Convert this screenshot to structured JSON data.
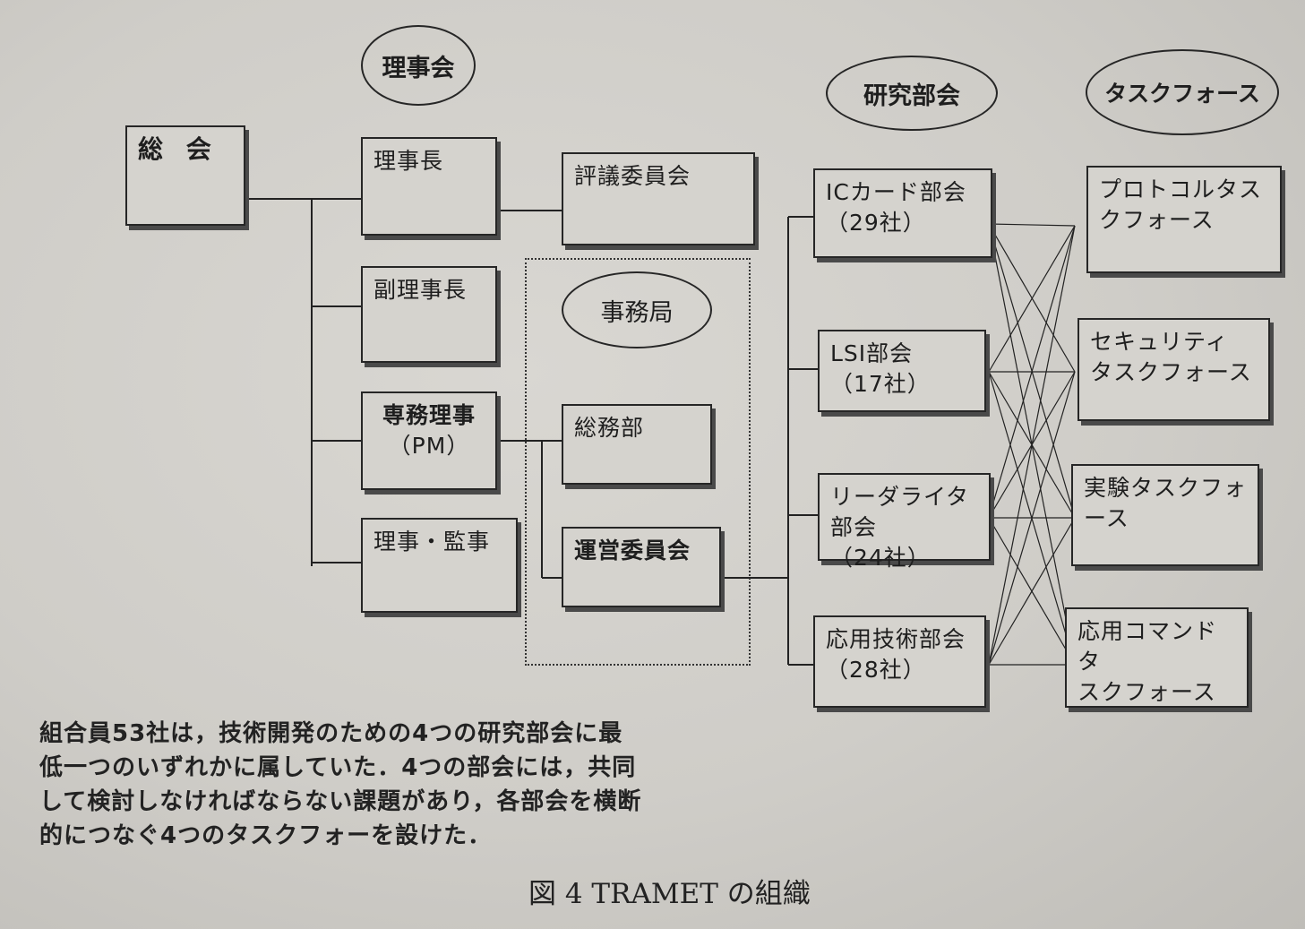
{
  "headers": {
    "rijikai": "理事会",
    "kenkyu": "研究部会",
    "taskforce": "タスクフォース",
    "jimukyoku": "事務局"
  },
  "boxes": {
    "soukai": "総  会",
    "rijicho": "理事長",
    "hyogi": "評議委員会",
    "fukurijicho": "副理事長",
    "senmu": "専務理事",
    "senmu_sub": "（PM）",
    "somubu": "総務部",
    "riji_kanji": "理事・監事",
    "unei": "運営委員会"
  },
  "research_groups": [
    {
      "name": "ICカード部会",
      "count": "（29社）"
    },
    {
      "name": "LSI部会",
      "count": "（17社）"
    },
    {
      "name": "リーダライタ部会",
      "count": "（24社）"
    },
    {
      "name": "応用技術部会",
      "count": "（28社）"
    }
  ],
  "task_forces": [
    {
      "line1": "プロトコルタス",
      "line2": "クフォース"
    },
    {
      "line1": "セキュリティ",
      "line2": "タスクフォース"
    },
    {
      "line1": "実験タスクフォ",
      "line2": "ース"
    },
    {
      "line1": "応用コマンドタ",
      "line2": "スクフォース"
    }
  ],
  "caption": {
    "line1": "組合員53社は，技術開発のための4つの研究部会に最",
    "line2": "低一つのいずれかに属していた．4つの部会には，共同",
    "line3": "して検討しなければならない課題があり，各部会を横断",
    "line4": "的につなぐ4つのタスクフォーを設けた．"
  },
  "figure_title": "図 4 TRAMET の組織"
}
